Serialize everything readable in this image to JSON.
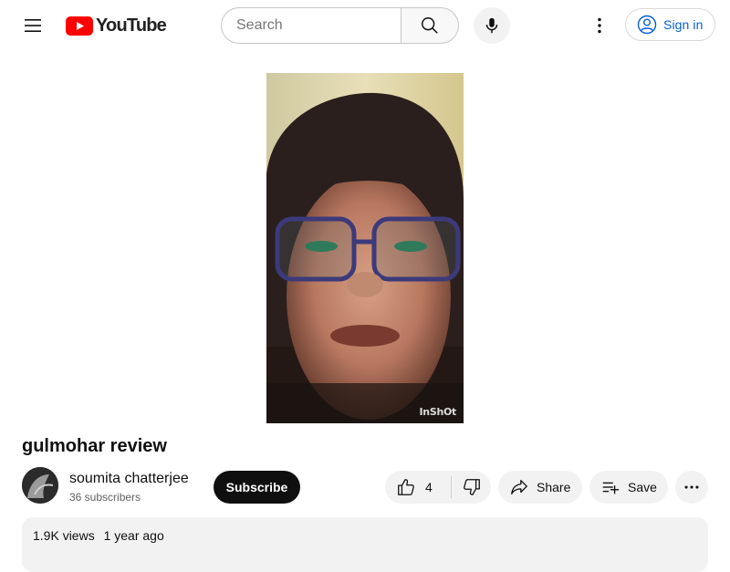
{
  "header": {
    "logo_text": "YouTube",
    "search_placeholder": "Search",
    "signin_label": "Sign in"
  },
  "video": {
    "title": "gulmohar review",
    "watermark": "InShOt"
  },
  "channel": {
    "name": "soumita chatterjee",
    "subscribers": "36 subscribers",
    "subscribe_label": "Subscribe"
  },
  "actions": {
    "like_count": "4",
    "share_label": "Share",
    "save_label": "Save"
  },
  "description": {
    "views": "1.9K views",
    "age": "1 year ago"
  },
  "colors": {
    "brand_red": "#ff0000",
    "link_blue": "#065fd4",
    "subscribe_bg": "#0f0f0f",
    "pill_bg": "#f2f2f2"
  }
}
